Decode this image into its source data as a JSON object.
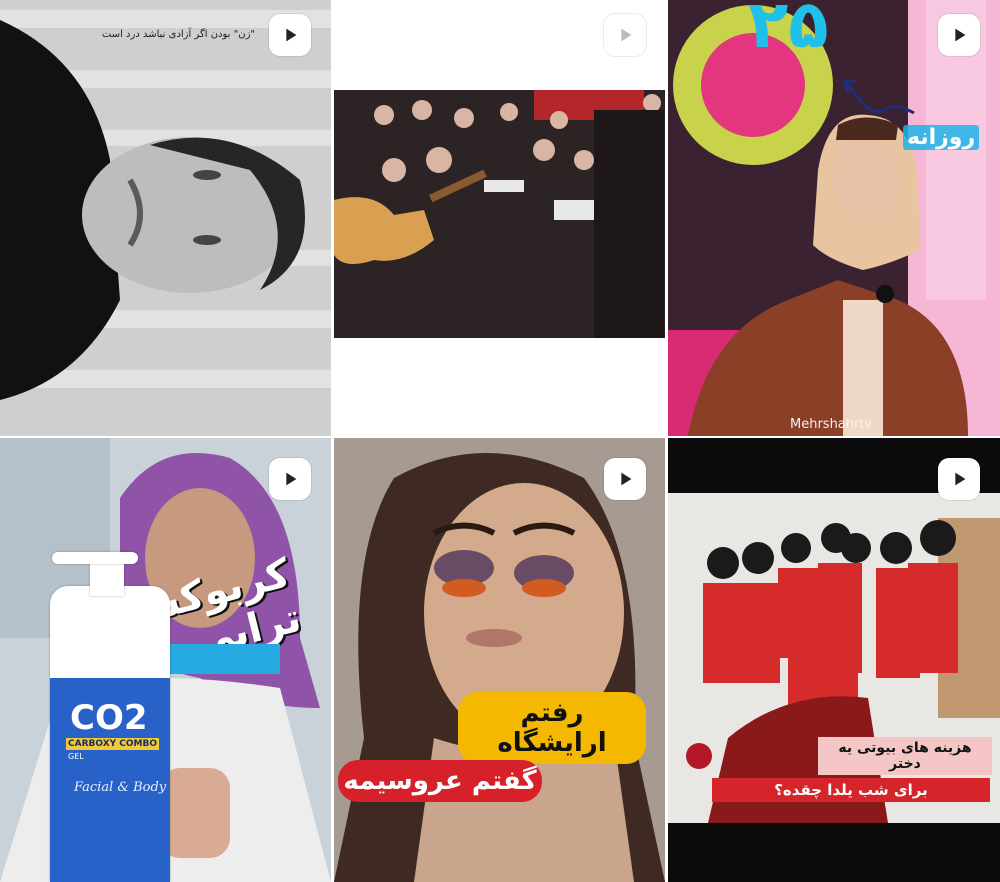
{
  "grid": {
    "tiles": [
      {
        "caption": "\"زن\" بودن اگر آزادی نباشد درد است"
      },
      {
        "caption": ""
      },
      {
        "number": "۲۵",
        "label": "روزانه",
        "watermark": "Mehrshahrtv"
      },
      {
        "headline": "کربوکسی تراپی",
        "product_name": "CO2",
        "product_sub": "CARBOXY COMBO",
        "product_gel": "GEL",
        "product_script": "Facial & Body"
      },
      {
        "line1": "رفتم ارایشگاه",
        "line2": "گفتم عروسیمه"
      },
      {
        "line1": "هزینه های بیوتی یه دختر",
        "line2": "برای شب یلدا چقده؟"
      }
    ]
  },
  "icons": {
    "play": "play-icon"
  },
  "colors": {
    "badge_bg": "#ffffff",
    "play_glyph": "#222222"
  }
}
